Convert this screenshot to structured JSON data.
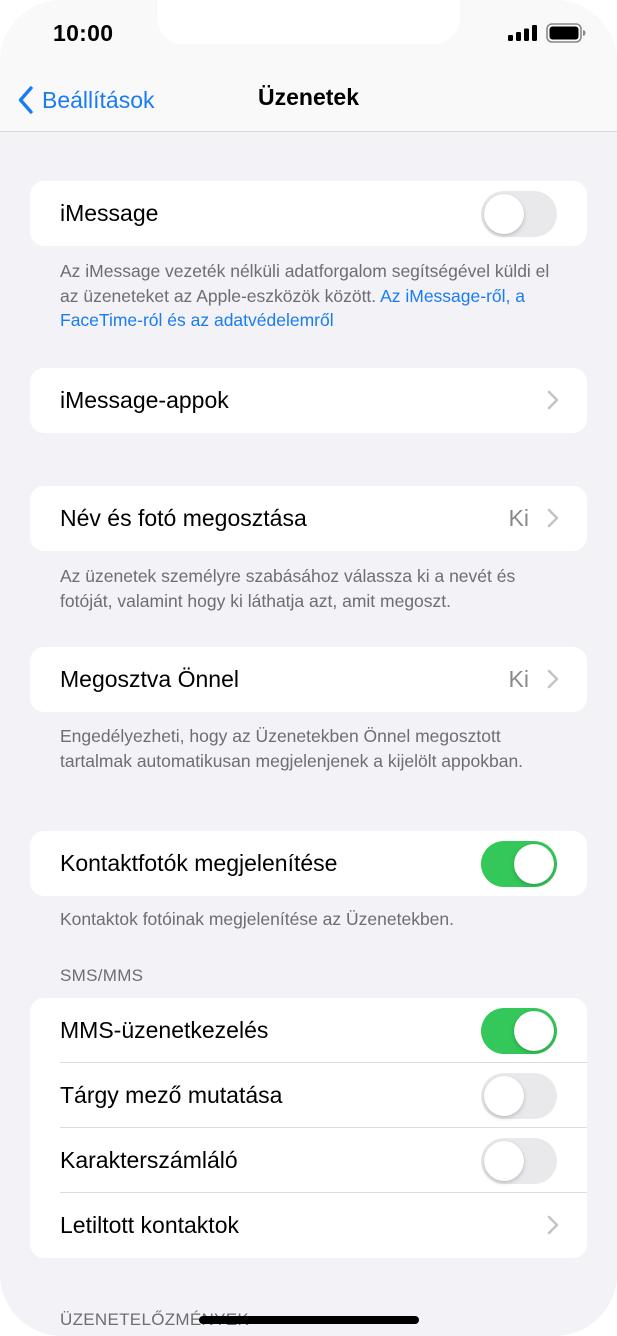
{
  "status_bar": {
    "time": "10:00",
    "signal_icon": "cellular-signal-icon",
    "battery_icon": "battery-icon"
  },
  "nav": {
    "back_label": "Beállítások",
    "title": "Üzenetek"
  },
  "imessage": {
    "label": "iMessage",
    "enabled": false,
    "footnote": "Az iMessage vezeték nélküli adatforgalom segítségével küldi el az üzeneteket az Apple-eszközök között. ",
    "footnote_link": "Az iMessage-ről, a FaceTime-ról és az adatvédelemről"
  },
  "imessage_apps": {
    "label": "iMessage-appok"
  },
  "name_photo": {
    "label": "Név és fotó megosztása",
    "value": "Ki",
    "footnote": "Az üzenetek személyre szabásához válassza ki a nevét és fotóját, valamint hogy ki láthatja azt, amit megoszt."
  },
  "shared_with_you": {
    "label": "Megosztva Önnel",
    "value": "Ki",
    "footnote": "Engedélyezheti, hogy az Üzenetekben Önnel megosztott tartalmak automatikusan megjelenjenek a kijelölt appokban."
  },
  "contact_photos": {
    "label": "Kontaktfotók megjelenítése",
    "enabled": true,
    "footnote": "Kontaktok fotóinak megjelenítése az Üzenetekben."
  },
  "sms_mms": {
    "header": "SMS/MMS",
    "items": [
      {
        "label": "MMS-üzenetkezelés",
        "type": "toggle",
        "enabled": true
      },
      {
        "label": "Tárgy mező mutatása",
        "type": "toggle",
        "enabled": false
      },
      {
        "label": "Karakterszámláló",
        "type": "toggle",
        "enabled": false
      },
      {
        "label": "Letiltott kontaktok",
        "type": "chevron"
      }
    ]
  },
  "history": {
    "header": "ÜZENETELŐZMÉNYEK"
  },
  "colors": {
    "accent": "#1a7cf4",
    "toggle_on": "#34c759",
    "toggle_off": "#e9e9eb",
    "background": "#f2f2f7"
  }
}
